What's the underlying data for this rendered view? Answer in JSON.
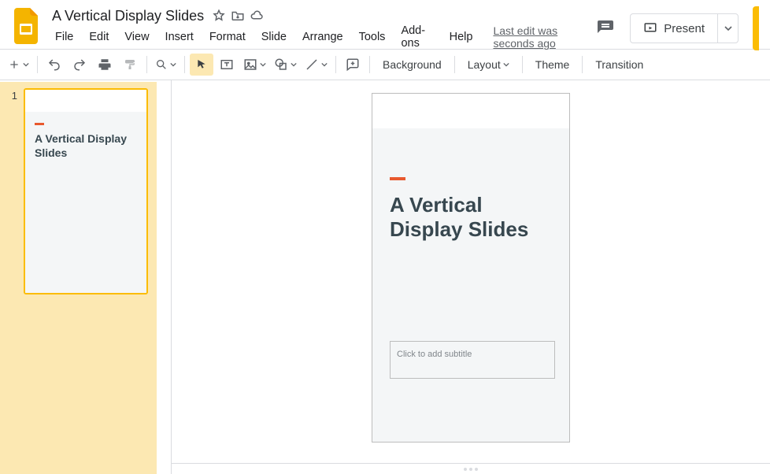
{
  "doc": {
    "title": "A Vertical Display Slides",
    "last_edit": "Last edit was seconds ago"
  },
  "menus": [
    "File",
    "Edit",
    "View",
    "Insert",
    "Format",
    "Slide",
    "Arrange",
    "Tools",
    "Add-ons",
    "Help"
  ],
  "present": {
    "label": "Present"
  },
  "toolbar_text": {
    "background": "Background",
    "layout": "Layout",
    "theme": "Theme",
    "transition": "Transition"
  },
  "filmstrip": {
    "slides": [
      {
        "number": "1",
        "title": "A Vertical Display Slides"
      }
    ]
  },
  "slide": {
    "title": "A Vertical Display Slides",
    "subtitle_placeholder": "Click to add subtitle"
  }
}
